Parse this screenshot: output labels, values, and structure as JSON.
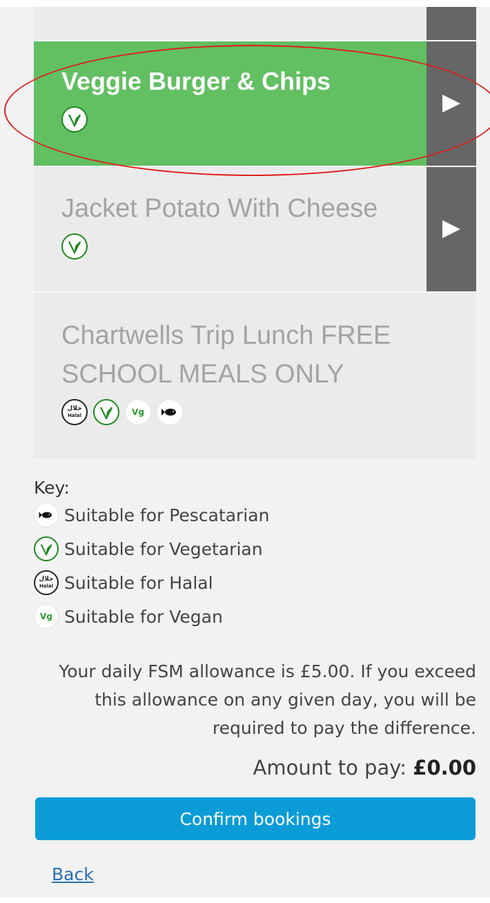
{
  "menu_items": [
    {
      "title": "Veggie Burger & Chips",
      "selected": true
    },
    {
      "title": "Jacket Potato With Cheese",
      "selected": false
    },
    {
      "title": "Chartwells Trip Lunch FREE SCHOOL MEALS ONLY",
      "selected": false
    }
  ],
  "icons": {
    "halal_arabic": "حلال",
    "halal_text": "Halal",
    "vegan_text": "Vg"
  },
  "key": {
    "title": "Key:",
    "items": [
      {
        "icon": "fish-icon",
        "label": "Suitable for Pescatarian"
      },
      {
        "icon": "vegetarian-icon",
        "label": "Suitable for Vegetarian"
      },
      {
        "icon": "halal-icon",
        "label": "Suitable for Halal"
      },
      {
        "icon": "vegan-icon",
        "label": "Suitable for Vegan"
      }
    ]
  },
  "notice": "Your daily FSM allowance is £5.00. If you exceed this allowance on any given day, you will be required to pay the difference.",
  "amount": {
    "label": "Amount to pay:",
    "value": "£0.00"
  },
  "confirm_label": "Confirm bookings",
  "back_label": "Back",
  "colors": {
    "selected": "#62bf62",
    "button": "#0b9cd8",
    "arrow_box": "#666666",
    "highlight_ring": "#e01b1b"
  }
}
